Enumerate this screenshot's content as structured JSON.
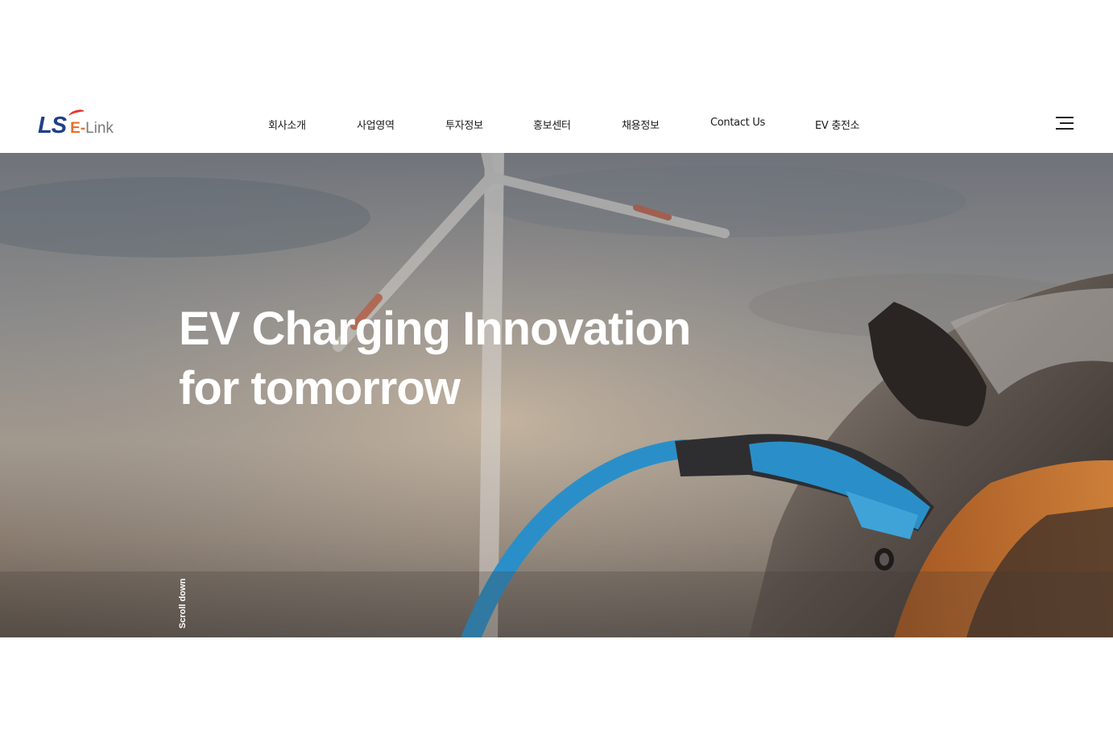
{
  "header": {
    "logo": {
      "mark": "LS",
      "e_text": "E-",
      "link_text": "Link"
    },
    "nav": [
      {
        "label": "회사소개"
      },
      {
        "label": "사업영역"
      },
      {
        "label": "투자정보"
      },
      {
        "label": "홍보센터"
      },
      {
        "label": "채용정보"
      },
      {
        "label": "Contact Us"
      },
      {
        "label": "EV 충전소"
      }
    ],
    "menu_icon": "hamburger-menu-icon"
  },
  "hero": {
    "title_line1": "EV Charging Innovation",
    "title_line2": "for tomorrow",
    "scroll_label": "Scroll down"
  },
  "colors": {
    "logo_blue": "#1f3f8a",
    "logo_orange": "#e8702a",
    "logo_red": "#e6332a",
    "logo_gray": "#7a7a7a",
    "cable_blue": "#2a8fc8"
  }
}
